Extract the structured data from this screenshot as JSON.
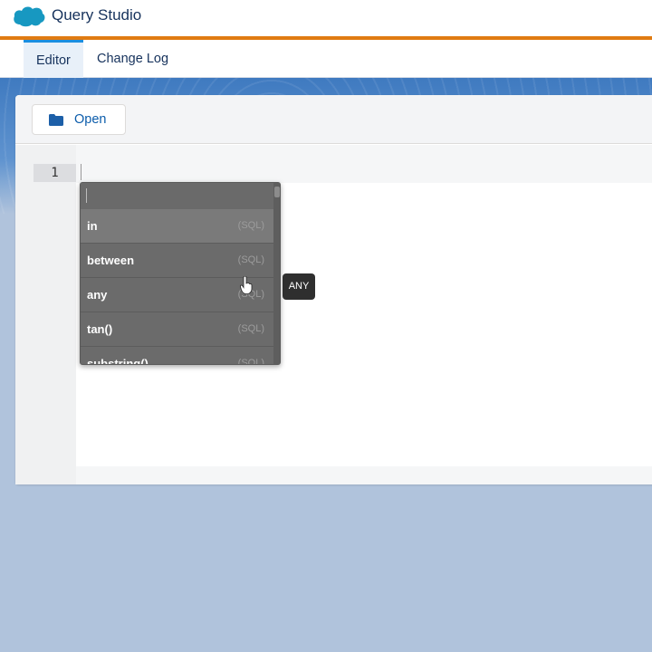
{
  "header": {
    "app_title": "Query Studio",
    "logo_icon": "salesforce-cloud-icon",
    "accent_color": "#e07b12"
  },
  "tabs": [
    {
      "label": "Editor",
      "active": true
    },
    {
      "label": "Change Log",
      "active": false
    }
  ],
  "toolbar": {
    "open_label": "Open",
    "open_icon": "folder-icon"
  },
  "editor": {
    "line_numbers": [
      "1"
    ],
    "content": ""
  },
  "autocomplete": {
    "search_placeholder": "",
    "items": [
      {
        "keyword": "in",
        "tag": "(SQL)",
        "highlighted": true
      },
      {
        "keyword": "between",
        "tag": "(SQL)",
        "highlighted": false
      },
      {
        "keyword": "any",
        "tag": "(SQL)",
        "highlighted": false
      },
      {
        "keyword": "tan()",
        "tag": "(SQL)",
        "highlighted": false
      },
      {
        "keyword": "substring()",
        "tag": "(SQL)",
        "highlighted": false
      }
    ]
  },
  "tooltip": {
    "text": "ANY"
  }
}
